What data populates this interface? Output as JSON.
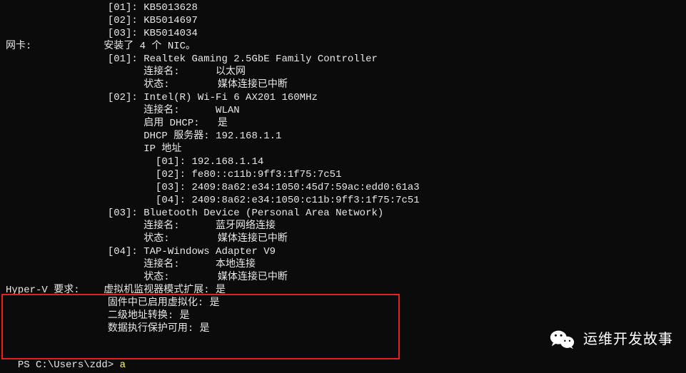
{
  "lines": [
    "                 [01]: KB5013628",
    "                 [02]: KB5014697",
    "                 [03]: KB5014034",
    "网卡:            安装了 4 个 NIC。",
    "                 [01]: Realtek Gaming 2.5GbE Family Controller",
    "                       连接名:      以太网",
    "                       状态:        媒体连接已中断",
    "                 [02]: Intel(R) Wi-Fi 6 AX201 160MHz",
    "                       连接名:      WLAN",
    "                       启用 DHCP:   是",
    "                       DHCP 服务器: 192.168.1.1",
    "                       IP 地址",
    "                         [01]: 192.168.1.14",
    "                         [02]: fe80::c11b:9ff3:1f75:7c51",
    "                         [03]: 2409:8a62:e34:1050:45d7:59ac:edd0:61a3",
    "                         [04]: 2409:8a62:e34:1050:c11b:9ff3:1f75:7c51",
    "                 [03]: Bluetooth Device (Personal Area Network)",
    "                       连接名:      蓝牙网络连接",
    "                       状态:        媒体连接已中断",
    "                 [04]: TAP-Windows Adapter V9",
    "                       连接名:      本地连接",
    "                       状态:        媒体连接已中断",
    "Hyper-V 要求:    虚拟机监视器模式扩展: 是",
    "                 固件中已启用虚拟化: 是",
    "                 二级地址转换: 是",
    "                 数据执行保护可用: 是"
  ],
  "prompt": {
    "ps": "PS C:\\Users\\zdd> ",
    "input": "a"
  },
  "watermark": {
    "text": "运维开发故事"
  }
}
